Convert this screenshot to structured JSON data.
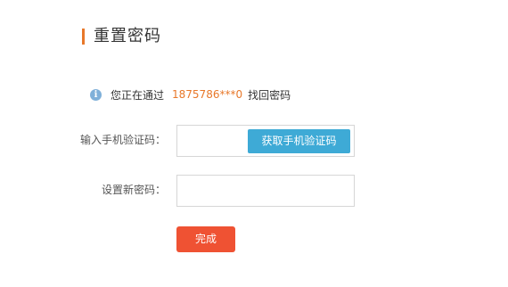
{
  "header": {
    "title": "重置密码",
    "accent_color": "#e8782a"
  },
  "notice": {
    "icon": "info-icon",
    "prefix": "您正在通过",
    "phone": "1875786***0",
    "suffix": "找回密码"
  },
  "form": {
    "code_label": "输入手机验证码：",
    "code_value": "",
    "get_code_button": "获取手机验证码",
    "new_password_label": "设置新密码：",
    "new_password_value": "",
    "submit_button": "完成"
  },
  "colors": {
    "primary_button": "#3eaad6",
    "submit_button": "#ef5233",
    "phone_highlight": "#e8782a"
  }
}
